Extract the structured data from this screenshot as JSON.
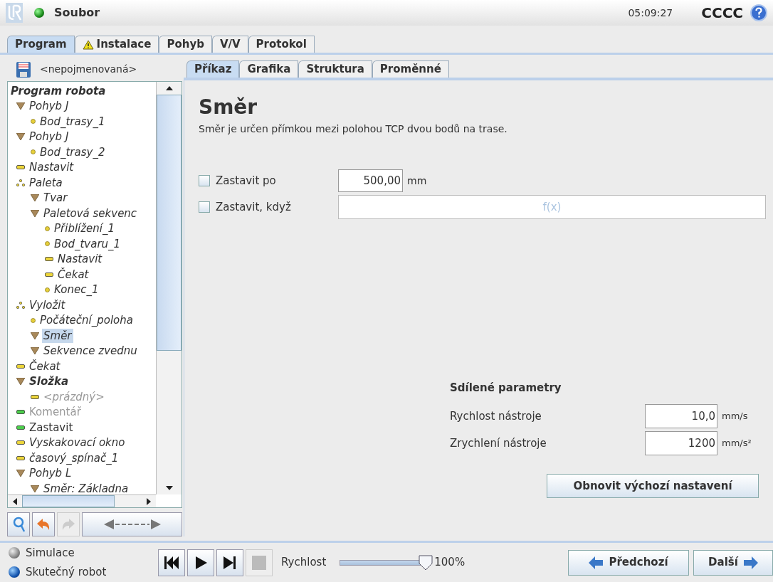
{
  "header": {
    "menu": "Soubor",
    "time": "05:09:27",
    "robot_name": "CCCC"
  },
  "main_tabs": [
    {
      "label": "Program",
      "selected": true,
      "warning": false
    },
    {
      "label": "Instalace",
      "selected": false,
      "warning": true
    },
    {
      "label": "Pohyb",
      "selected": false,
      "warning": false
    },
    {
      "label": "V/V",
      "selected": false,
      "warning": false
    },
    {
      "label": "Protokol",
      "selected": false,
      "warning": false
    }
  ],
  "program_name": "<nepojmenovaná>",
  "tree": {
    "label": "Program robota",
    "kind": "root",
    "bold": true,
    "italic": true,
    "disabled": false,
    "selected": false,
    "children": [
      {
        "label": "Pohyb J",
        "kind": "move",
        "bold": false,
        "italic": true,
        "disabled": false,
        "selected": false,
        "children": [
          {
            "label": "Bod_trasy_1",
            "kind": "waypoint",
            "bold": false,
            "italic": true,
            "disabled": false,
            "selected": false
          }
        ]
      },
      {
        "label": "Pohyb J",
        "kind": "move",
        "bold": false,
        "italic": true,
        "disabled": false,
        "selected": false,
        "children": [
          {
            "label": "Bod_trasy_2",
            "kind": "waypoint",
            "bold": false,
            "italic": true,
            "disabled": false,
            "selected": false
          }
        ]
      },
      {
        "label": "Nastavit",
        "kind": "action",
        "bold": false,
        "italic": true,
        "disabled": false,
        "selected": false
      },
      {
        "label": "Paleta",
        "kind": "pattern",
        "bold": false,
        "italic": true,
        "disabled": false,
        "selected": false,
        "children": [
          {
            "label": "Tvar",
            "kind": "move",
            "bold": false,
            "italic": true,
            "disabled": false,
            "selected": false
          },
          {
            "label": "Paletová sekvenc",
            "kind": "move",
            "bold": false,
            "italic": true,
            "disabled": false,
            "selected": false,
            "children": [
              {
                "label": "Přiblížení_1",
                "kind": "waypoint",
                "bold": false,
                "italic": true,
                "disabled": false,
                "selected": false
              },
              {
                "label": "Bod_tvaru_1",
                "kind": "waypoint",
                "bold": false,
                "italic": true,
                "disabled": false,
                "selected": false
              },
              {
                "label": "Nastavit",
                "kind": "action",
                "bold": false,
                "italic": true,
                "disabled": false,
                "selected": false
              },
              {
                "label": "Čekat",
                "kind": "action",
                "bold": false,
                "italic": true,
                "disabled": false,
                "selected": false
              },
              {
                "label": "Konec_1",
                "kind": "waypoint",
                "bold": false,
                "italic": true,
                "disabled": false,
                "selected": false
              }
            ]
          }
        ]
      },
      {
        "label": "Vyložit",
        "kind": "pattern",
        "bold": false,
        "italic": true,
        "disabled": false,
        "selected": false,
        "children": [
          {
            "label": "Počáteční_poloha",
            "kind": "waypoint",
            "bold": false,
            "italic": true,
            "disabled": false,
            "selected": false
          },
          {
            "label": "Směr",
            "kind": "move",
            "bold": false,
            "italic": true,
            "disabled": false,
            "selected": true
          },
          {
            "label": "Sekvence zvednu",
            "kind": "move",
            "bold": false,
            "italic": true,
            "disabled": false,
            "selected": false
          }
        ]
      },
      {
        "label": "Čekat",
        "kind": "action",
        "bold": false,
        "italic": true,
        "disabled": false,
        "selected": false
      },
      {
        "label": "Složka",
        "kind": "move",
        "bold": true,
        "italic": true,
        "disabled": false,
        "selected": false,
        "children": [
          {
            "label": "<prázdný>",
            "kind": "action",
            "bold": false,
            "italic": true,
            "disabled": true,
            "selected": false
          }
        ]
      },
      {
        "label": "Komentář",
        "kind": "comment",
        "bold": false,
        "italic": false,
        "disabled": true,
        "selected": false
      },
      {
        "label": "Zastavit",
        "kind": "comment",
        "bold": false,
        "italic": false,
        "disabled": false,
        "selected": false
      },
      {
        "label": "Vyskakovací okno",
        "kind": "action",
        "bold": false,
        "italic": true,
        "disabled": false,
        "selected": false
      },
      {
        "label": "časový_spínač_1",
        "kind": "action",
        "bold": false,
        "italic": true,
        "disabled": false,
        "selected": false
      },
      {
        "label": "Pohyb L",
        "kind": "move",
        "bold": false,
        "italic": true,
        "disabled": false,
        "selected": false,
        "children": [
          {
            "label": "Směr: Základna",
            "kind": "move",
            "bold": false,
            "italic": true,
            "disabled": false,
            "selected": false
          }
        ]
      }
    ]
  },
  "sub_tabs": [
    {
      "label": "Příkaz",
      "selected": true
    },
    {
      "label": "Grafika",
      "selected": false
    },
    {
      "label": "Struktura",
      "selected": false
    },
    {
      "label": "Proměnné",
      "selected": false
    }
  ],
  "command": {
    "title": "Směr",
    "description": "Směr je určen přímkou mezi polohou TCP dvou bodů na trase.",
    "stop_after": {
      "label": "Zastavit po",
      "checked": false,
      "value": "500,00",
      "unit": "mm"
    },
    "stop_when": {
      "label": "Zastavit, když",
      "checked": false,
      "placeholder": "f(x)"
    },
    "shared": {
      "heading": "Sdílené parametry",
      "rows": [
        {
          "label": "Rychlost nástroje",
          "value": "10,0",
          "unit": "mm/s"
        },
        {
          "label": "Zrychlení nástroje",
          "value": "1200",
          "unit": "mm/s²"
        }
      ],
      "reset_button": "Obnovit výchozí nastavení"
    }
  },
  "footer": {
    "modes": [
      {
        "label": "Simulace",
        "selected": false
      },
      {
        "label": "Skutečný robot",
        "selected": true
      }
    ],
    "speed_label": "Rychlost",
    "speed": {
      "level": 1.0
    },
    "speed_reading": "100%",
    "prev": "Předchozí",
    "next": "Další"
  }
}
